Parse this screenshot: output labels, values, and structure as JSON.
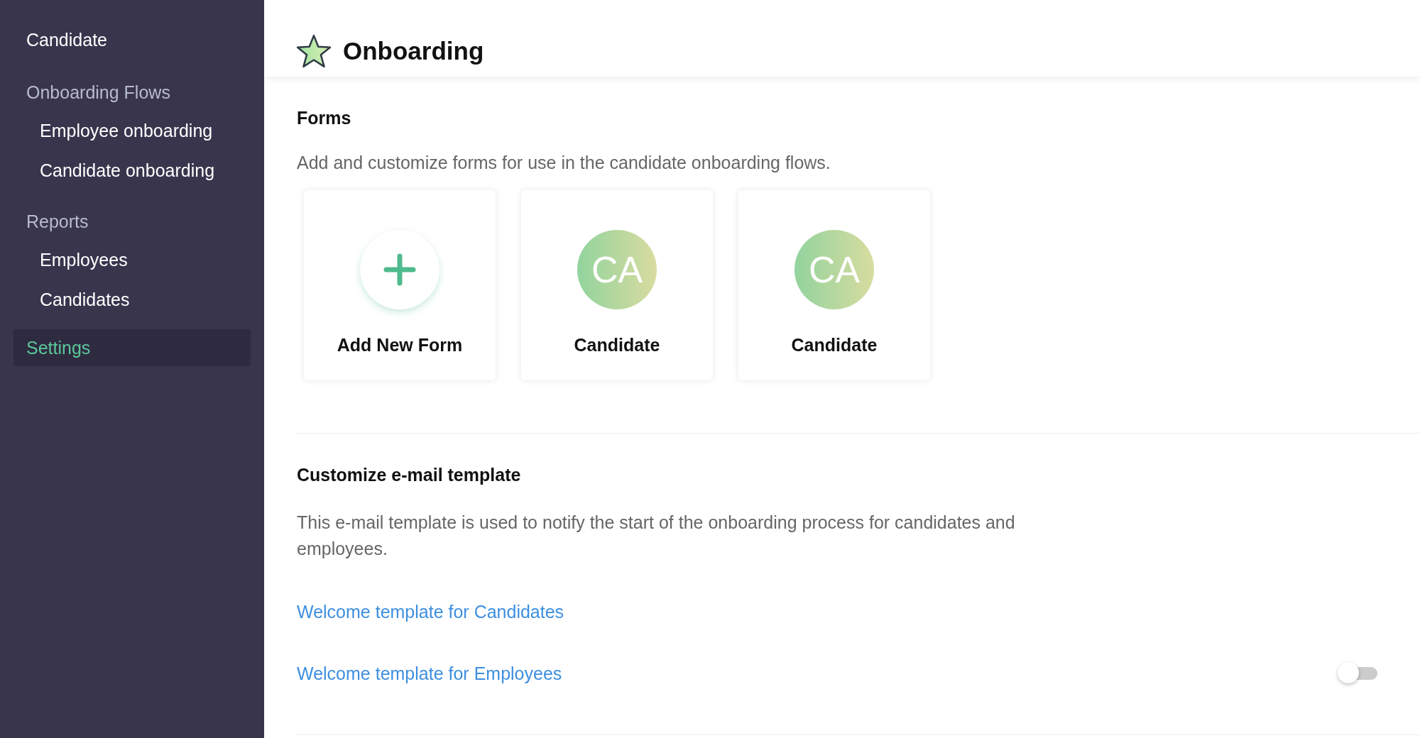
{
  "sidebar": {
    "items": [
      {
        "label": "Candidate",
        "kind": "top",
        "selected": false
      },
      {
        "label": "Onboarding Flows",
        "kind": "heading",
        "selected": false
      },
      {
        "label": "Employee onboarding",
        "kind": "sub",
        "selected": false
      },
      {
        "label": "Candidate onboarding",
        "kind": "sub",
        "selected": false
      },
      {
        "label": "Reports",
        "kind": "heading",
        "selected": false
      },
      {
        "label": "Employees",
        "kind": "sub",
        "selected": false
      },
      {
        "label": "Candidates",
        "kind": "sub",
        "selected": false
      },
      {
        "label": "Settings",
        "kind": "top",
        "selected": true
      }
    ]
  },
  "header": {
    "title": "Onboarding"
  },
  "forms": {
    "heading": "Forms",
    "description": "Add and customize forms for use in the candidate onboarding flows.",
    "cards": [
      {
        "kind": "add",
        "label": "Add New Form"
      },
      {
        "kind": "form",
        "initials": "CA",
        "label": "Candidate"
      },
      {
        "kind": "form",
        "initials": "CA",
        "label": "Candidate"
      }
    ]
  },
  "email": {
    "heading": "Customize e-mail template",
    "description": "This e-mail template is used to notify the start of the onboarding process for candidates and employees.",
    "templates": [
      {
        "label": "Welcome template for Candidates"
      },
      {
        "label": "Welcome template for Employees",
        "toggle": {
          "on": false
        }
      }
    ]
  }
}
